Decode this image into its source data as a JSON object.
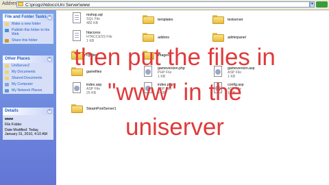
{
  "address_bar": {
    "label": "Address",
    "path": "C:\\progs\\htdocs\\Uni Server\\www",
    "go_label": ""
  },
  "task_pane": {
    "file_tasks": {
      "title": "File and Folder Tasks",
      "items": [
        "Make a new folder",
        "Publish this folder to the Web",
        "Share this folder"
      ]
    },
    "other_places": {
      "title": "Other Places",
      "items": [
        "UniServerZ",
        "My Documents",
        "Shared Documents",
        "My Computer",
        "My Network Places"
      ]
    },
    "details": {
      "title": "Details",
      "name": "www",
      "type": "File Folder",
      "modified": "Date Modified: Today, January 31, 2010, 4:10 AM"
    }
  },
  "files": {
    "col1": [
      {
        "name": "mshop.sql",
        "type": "SQL File",
        "size": "482 KB",
        "kind": "file"
      },
      {
        "name": "htaccess",
        "type": "HTACCESS File",
        "size": "1 KB",
        "kind": "file"
      },
      {
        "name": "cgi-bin",
        "kind": "folder"
      },
      {
        "name": "gamefiles",
        "kind": "folder"
      },
      {
        "name": "index.asp",
        "type": "ASP File",
        "size": "25 KB",
        "kind": "file"
      },
      {
        "name": "SteamPoolServer1",
        "kind": "folder"
      }
    ],
    "col2": [
      {
        "name": "templates",
        "kind": "folder"
      },
      {
        "name": "addons",
        "kind": "folder"
      },
      {
        "name": "images",
        "kind": "folder"
      },
      {
        "name": "gameversion.php",
        "type": "PHP File",
        "size": "1 KB",
        "kind": "file"
      },
      {
        "name": "index.php",
        "type": "ASP File",
        "size": "4 KB",
        "kind": "file"
      }
    ],
    "col3": [
      {
        "name": "testserver",
        "kind": "folder"
      },
      {
        "name": "adminpanel",
        "kind": "folder"
      },
      {
        "name": "gameversion.asp",
        "type": "ASP File",
        "size": "1 KB",
        "kind": "file"
      },
      {
        "name": "config.asp",
        "type": "ASP File",
        "size": "1 KB",
        "kind": "file"
      }
    ]
  },
  "caption": {
    "lines": [
      "then put the files in",
      "\"www\" in the",
      "uniserver"
    ],
    "color": "#e03a3a"
  }
}
